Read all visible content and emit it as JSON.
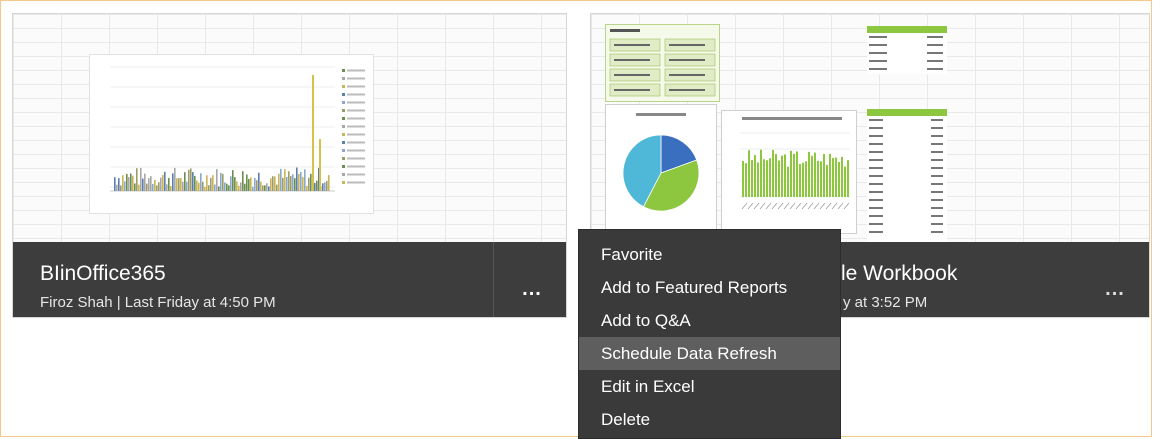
{
  "reports": [
    {
      "title": "BIinOffice365",
      "subtitle": "Firoz Shah | Last Friday at 4:50 PM",
      "more_label": "..."
    },
    {
      "title": "le Workbook",
      "subtitle": "y at 3:52 PM",
      "more_label": "..."
    }
  ],
  "context_menu": {
    "items": [
      "Favorite",
      "Add to Featured Reports",
      "Add to Q&A",
      "Schedule Data Refresh",
      "Edit in Excel",
      "Delete"
    ],
    "highlighted": "Schedule Data Refresh"
  },
  "colors": {
    "footer_bg": "#3d3d3d",
    "menu_bg": "#3a3a3a",
    "menu_hover": "#5e5e5e",
    "frame_border": "#f3c98a",
    "pie_blue": "#3a6fbf",
    "pie_cyan": "#4fb8d8",
    "pie_green": "#8dc63f"
  }
}
